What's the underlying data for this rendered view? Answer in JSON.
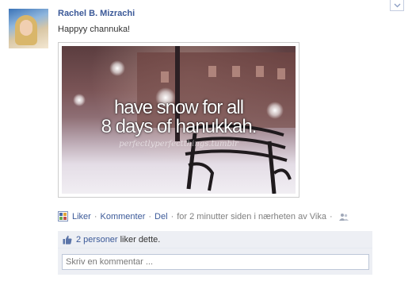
{
  "post": {
    "author": "Rachel B. Mizrachi",
    "message": "Happyy channuka!",
    "photo": {
      "caption_line1": "have snow for all",
      "caption_line2": "8 days of hanukkah.",
      "credit": "perfectlyperfectthings.tumblr"
    }
  },
  "actions": {
    "like": "Liker",
    "comment": "Kommenter",
    "share": "Del",
    "meta": "for 2 minutter siden i nærheten av Vika"
  },
  "likes": {
    "count_link": "2 personer",
    "suffix": "liker dette."
  },
  "comment_input": {
    "placeholder": "Skriv en kommentar ..."
  },
  "colors": {
    "link": "#3b5998",
    "meta": "#808080",
    "panel": "#edeff4"
  },
  "icons": [
    "chevron-down-icon",
    "app-icon",
    "friends-icon",
    "thumbs-up-icon"
  ]
}
